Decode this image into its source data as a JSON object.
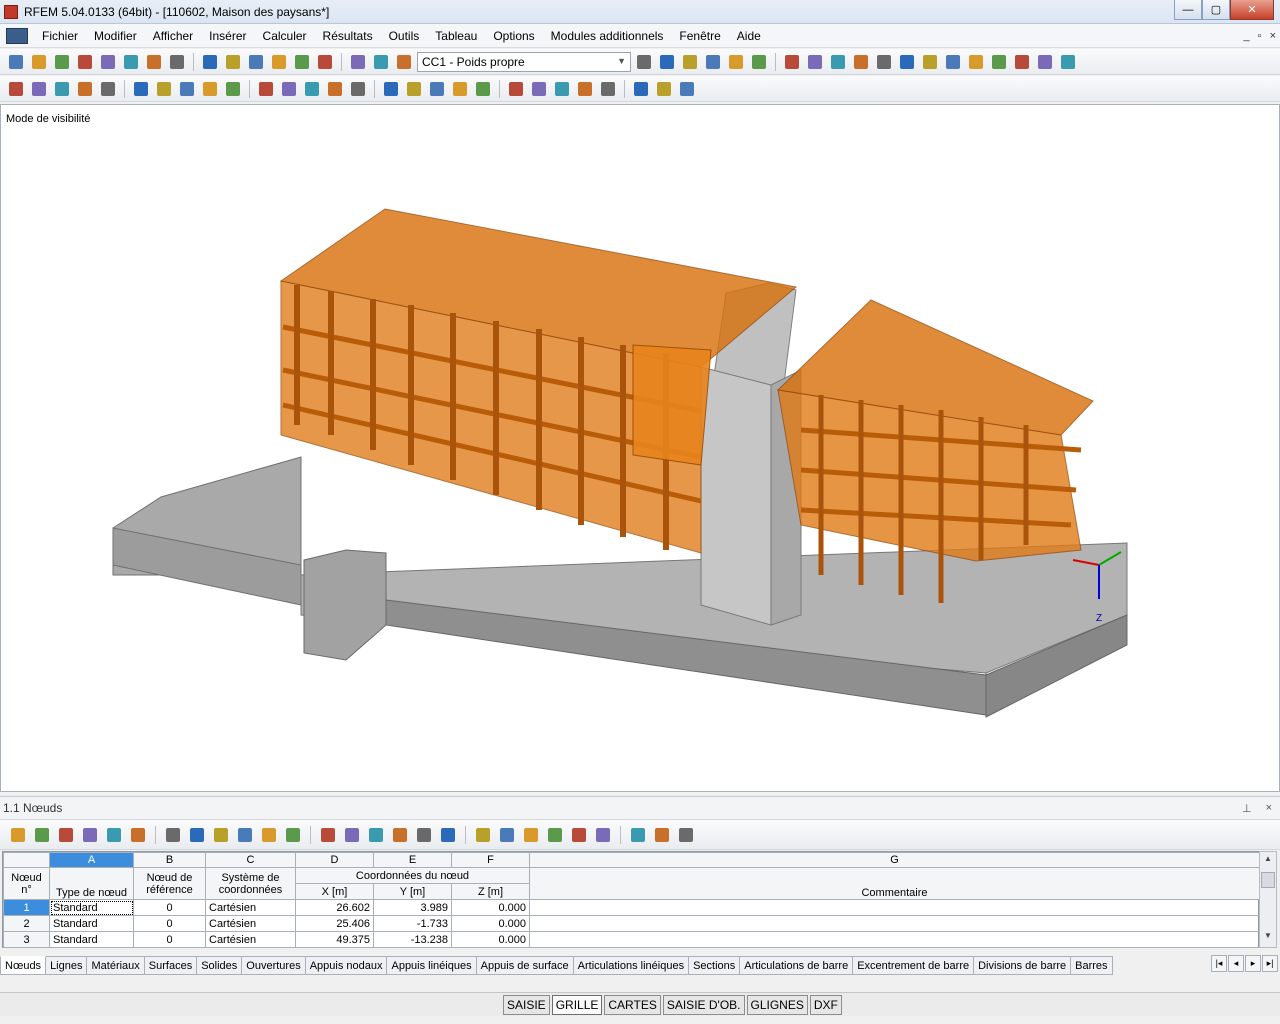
{
  "window": {
    "title": "RFEM 5.04.0133 (64bit) - [110602, Maison des paysans*]",
    "controls": [
      "—",
      "▢",
      "✕"
    ]
  },
  "menu": {
    "items": [
      "Fichier",
      "Modifier",
      "Afficher",
      "Insérer",
      "Calculer",
      "Résultats",
      "Outils",
      "Tableau",
      "Options",
      "Modules additionnels",
      "Fenêtre",
      "Aide"
    ],
    "mdi_controls": [
      "_",
      "▫",
      "×"
    ]
  },
  "toolbar": {
    "load_case": "CC1 - Poids propre",
    "icons1": [
      "new-icon",
      "open-icon",
      "open-template-icon",
      "save-all-icon",
      "save-icon",
      "print-icon",
      "print-preview-icon",
      "print-report-icon",
      "undo-icon",
      "redo-icon",
      "edit-icon",
      "search-icon",
      "select-icon",
      "window-icon",
      "table-icon",
      "grid-icon",
      "load-icon",
      "prev-load-icon",
      "next-load-icon",
      "results-icon",
      "deformation-icon",
      "show-values-icon",
      "animate-icon",
      "view-icon",
      "view2-icon",
      "render-icon",
      "solid-icon",
      "wire-icon",
      "mesh-icon",
      "sections-icon",
      "iso-icon",
      "frame-icon",
      "x-icon",
      "circle-icon",
      "settings-icon",
      "export-icon"
    ],
    "icons2": [
      "node-icon",
      "line-icon",
      "member-icon",
      "support-icon",
      "hinge-icon",
      "load-icon",
      "surface-icon",
      "opening-icon",
      "solid-icon",
      "cut-icon",
      "view-icon",
      "zoom-icon",
      "pan-icon",
      "rotate-icon",
      "copy-icon",
      "move-icon",
      "mirror-icon",
      "divide-icon",
      "merge-icon",
      "check-icon",
      "xyz-icon",
      "project-icon",
      "clip-icon",
      "measure-icon",
      "select-icon",
      "filter-icon",
      "group-icon",
      "grid-icon"
    ]
  },
  "viewport": {
    "visibility_mode_label": "Mode de visibilité",
    "axes": {
      "z_label": "Z"
    }
  },
  "panel": {
    "title": "1.1 Nœuds",
    "controls": [
      "⊥",
      "×"
    ],
    "toolbar_icons": [
      "table-view-icon",
      "filter-icon",
      "sort-icon",
      "export-icon",
      "colors-icon",
      "prev-icon",
      "next-icon",
      "select-icon",
      "edit-icon",
      "refresh-icon",
      "insert-row-icon",
      "delete-row-icon",
      "copy-row-icon",
      "clear-icon",
      "cut-icon",
      "paste-icon",
      "move-icon",
      "column-icon",
      "hide-icon",
      "chart-icon",
      "excel-icon",
      "import-icon",
      "calc-icon",
      "graph-icon",
      "function-icon",
      "formula-icon",
      "lock-icon"
    ]
  },
  "table": {
    "column_letters": [
      "A",
      "B",
      "C",
      "D",
      "E",
      "F",
      "G"
    ],
    "headers": {
      "node_no": "Nœud n°",
      "type": "Type de nœud",
      "ref_node": "Nœud de référence",
      "coord_system": "Système de coordonnées",
      "coords_group": "Coordonnées du nœud",
      "x": "X [m]",
      "y": "Y [m]",
      "z": "Z [m]",
      "comment": "Commentaire"
    },
    "rows": [
      {
        "no": "1",
        "type": "Standard",
        "ref": "0",
        "system": "Cartésien",
        "x": "26.602",
        "y": "3.989",
        "z": "0.000",
        "comment": ""
      },
      {
        "no": "2",
        "type": "Standard",
        "ref": "0",
        "system": "Cartésien",
        "x": "25.406",
        "y": "-1.733",
        "z": "0.000",
        "comment": ""
      },
      {
        "no": "3",
        "type": "Standard",
        "ref": "0",
        "system": "Cartésien",
        "x": "49.375",
        "y": "-13.238",
        "z": "0.000",
        "comment": ""
      }
    ]
  },
  "tabs": [
    "Nœuds",
    "Lignes",
    "Matériaux",
    "Surfaces",
    "Solides",
    "Ouvertures",
    "Appuis nodaux",
    "Appuis linéiques",
    "Appuis de surface",
    "Articulations linéiques",
    "Sections",
    "Articulations de barre",
    "Excentrement de barre",
    "Divisions de barre",
    "Barres"
  ],
  "status": {
    "toggles": [
      {
        "label": "SAISIE",
        "on": false
      },
      {
        "label": "GRILLE",
        "on": true
      },
      {
        "label": "CARTES",
        "on": false
      },
      {
        "label": "SAISIE D'OB.",
        "on": false
      },
      {
        "label": "GLIGNES",
        "on": false
      },
      {
        "label": "DXF",
        "on": false
      }
    ]
  },
  "colors": {
    "timber": "#d8720f",
    "concrete": "#9a9a9a",
    "selection": "#3c8dde"
  }
}
